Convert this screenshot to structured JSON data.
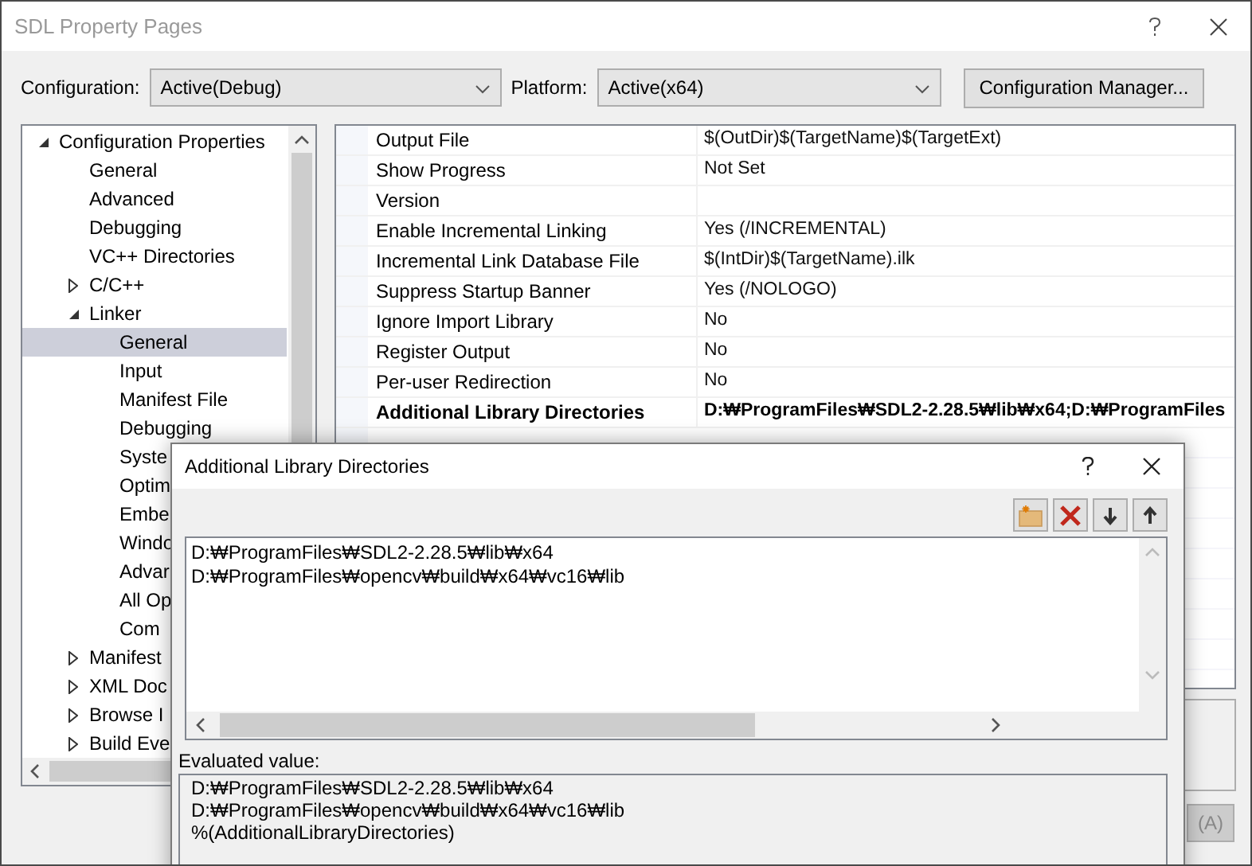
{
  "window": {
    "title": "SDL Property Pages"
  },
  "toolbar": {
    "configuration_label": "Configuration:",
    "configuration": "Active(Debug)",
    "platform_label": "Platform:",
    "platform": "Active(x64)",
    "manager_button": "Configuration Manager..."
  },
  "tree": [
    {
      "label": "Configuration Properties",
      "expanded": true,
      "selected": false,
      "children": [
        {
          "label": "General",
          "selected": false
        },
        {
          "label": "Advanced",
          "selected": false
        },
        {
          "label": "Debugging",
          "selected": false
        },
        {
          "label": "VC++ Directories",
          "selected": false
        },
        {
          "label": "C/C++",
          "expanded": false,
          "selected": false
        },
        {
          "label": "Linker",
          "expanded": true,
          "selected": false,
          "children": [
            {
              "label": "General",
              "selected": true
            },
            {
              "label": "Input",
              "selected": false
            },
            {
              "label": "Manifest File",
              "selected": false
            },
            {
              "label": "Debugging",
              "selected": false
            },
            {
              "label": "Syste",
              "selected": false
            },
            {
              "label": "Optim",
              "selected": false
            },
            {
              "label": "Embe",
              "selected": false
            },
            {
              "label": "Windo",
              "selected": false
            },
            {
              "label": "Advar",
              "selected": false
            },
            {
              "label": "All Op",
              "selected": false
            },
            {
              "label": "Com",
              "selected": false
            }
          ]
        },
        {
          "label": "Manifest",
          "expanded": false,
          "selected": false
        },
        {
          "label": "XML Doc",
          "expanded": false,
          "selected": false
        },
        {
          "label": "Browse I",
          "expanded": false,
          "selected": false
        },
        {
          "label": "Build Eve",
          "expanded": false,
          "selected": false
        }
      ]
    }
  ],
  "properties": [
    {
      "name": "Output File",
      "value": "$(OutDir)$(TargetName)$(TargetExt)",
      "modified": false
    },
    {
      "name": "Show Progress",
      "value": "Not Set",
      "modified": false
    },
    {
      "name": "Version",
      "modified": false
    },
    {
      "name": "Enable Incremental Linking",
      "value": "Yes (/INCREMENTAL)",
      "modified": false
    },
    {
      "name": "Incremental Link Database File",
      "value": "$(IntDir)$(TargetName).ilk",
      "modified": false
    },
    {
      "name": "Suppress Startup Banner",
      "value": "Yes (/NOLOGO)",
      "modified": false
    },
    {
      "name": "Ignore Import Library",
      "value": "No",
      "modified": false
    },
    {
      "name": "Register Output",
      "value": "No",
      "modified": false
    },
    {
      "name": "Per-user Redirection",
      "value": "No",
      "modified": false
    },
    {
      "name": "Additional Library Directories",
      "value": "D:₩ProgramFiles₩SDL2-2.28.5₩lib₩x64;D:₩ProgramFiles",
      "modified": true
    }
  ],
  "footer_buttons": [
    "(A)"
  ],
  "dialog": {
    "title": "Additional Library Directories",
    "lines": [
      "D:₩ProgramFiles₩SDL2-2.28.5₩lib₩x64",
      "D:₩ProgramFiles₩opencv₩build₩x64₩vc16₩lib"
    ],
    "evaluated_label": "Evaluated value:",
    "evaluated_lines": [
      "D:₩ProgramFiles₩SDL2-2.28.5₩lib₩x64",
      "D:₩ProgramFiles₩opencv₩build₩x64₩vc16₩lib",
      "%(AdditionalLibraryDirectories)"
    ]
  }
}
